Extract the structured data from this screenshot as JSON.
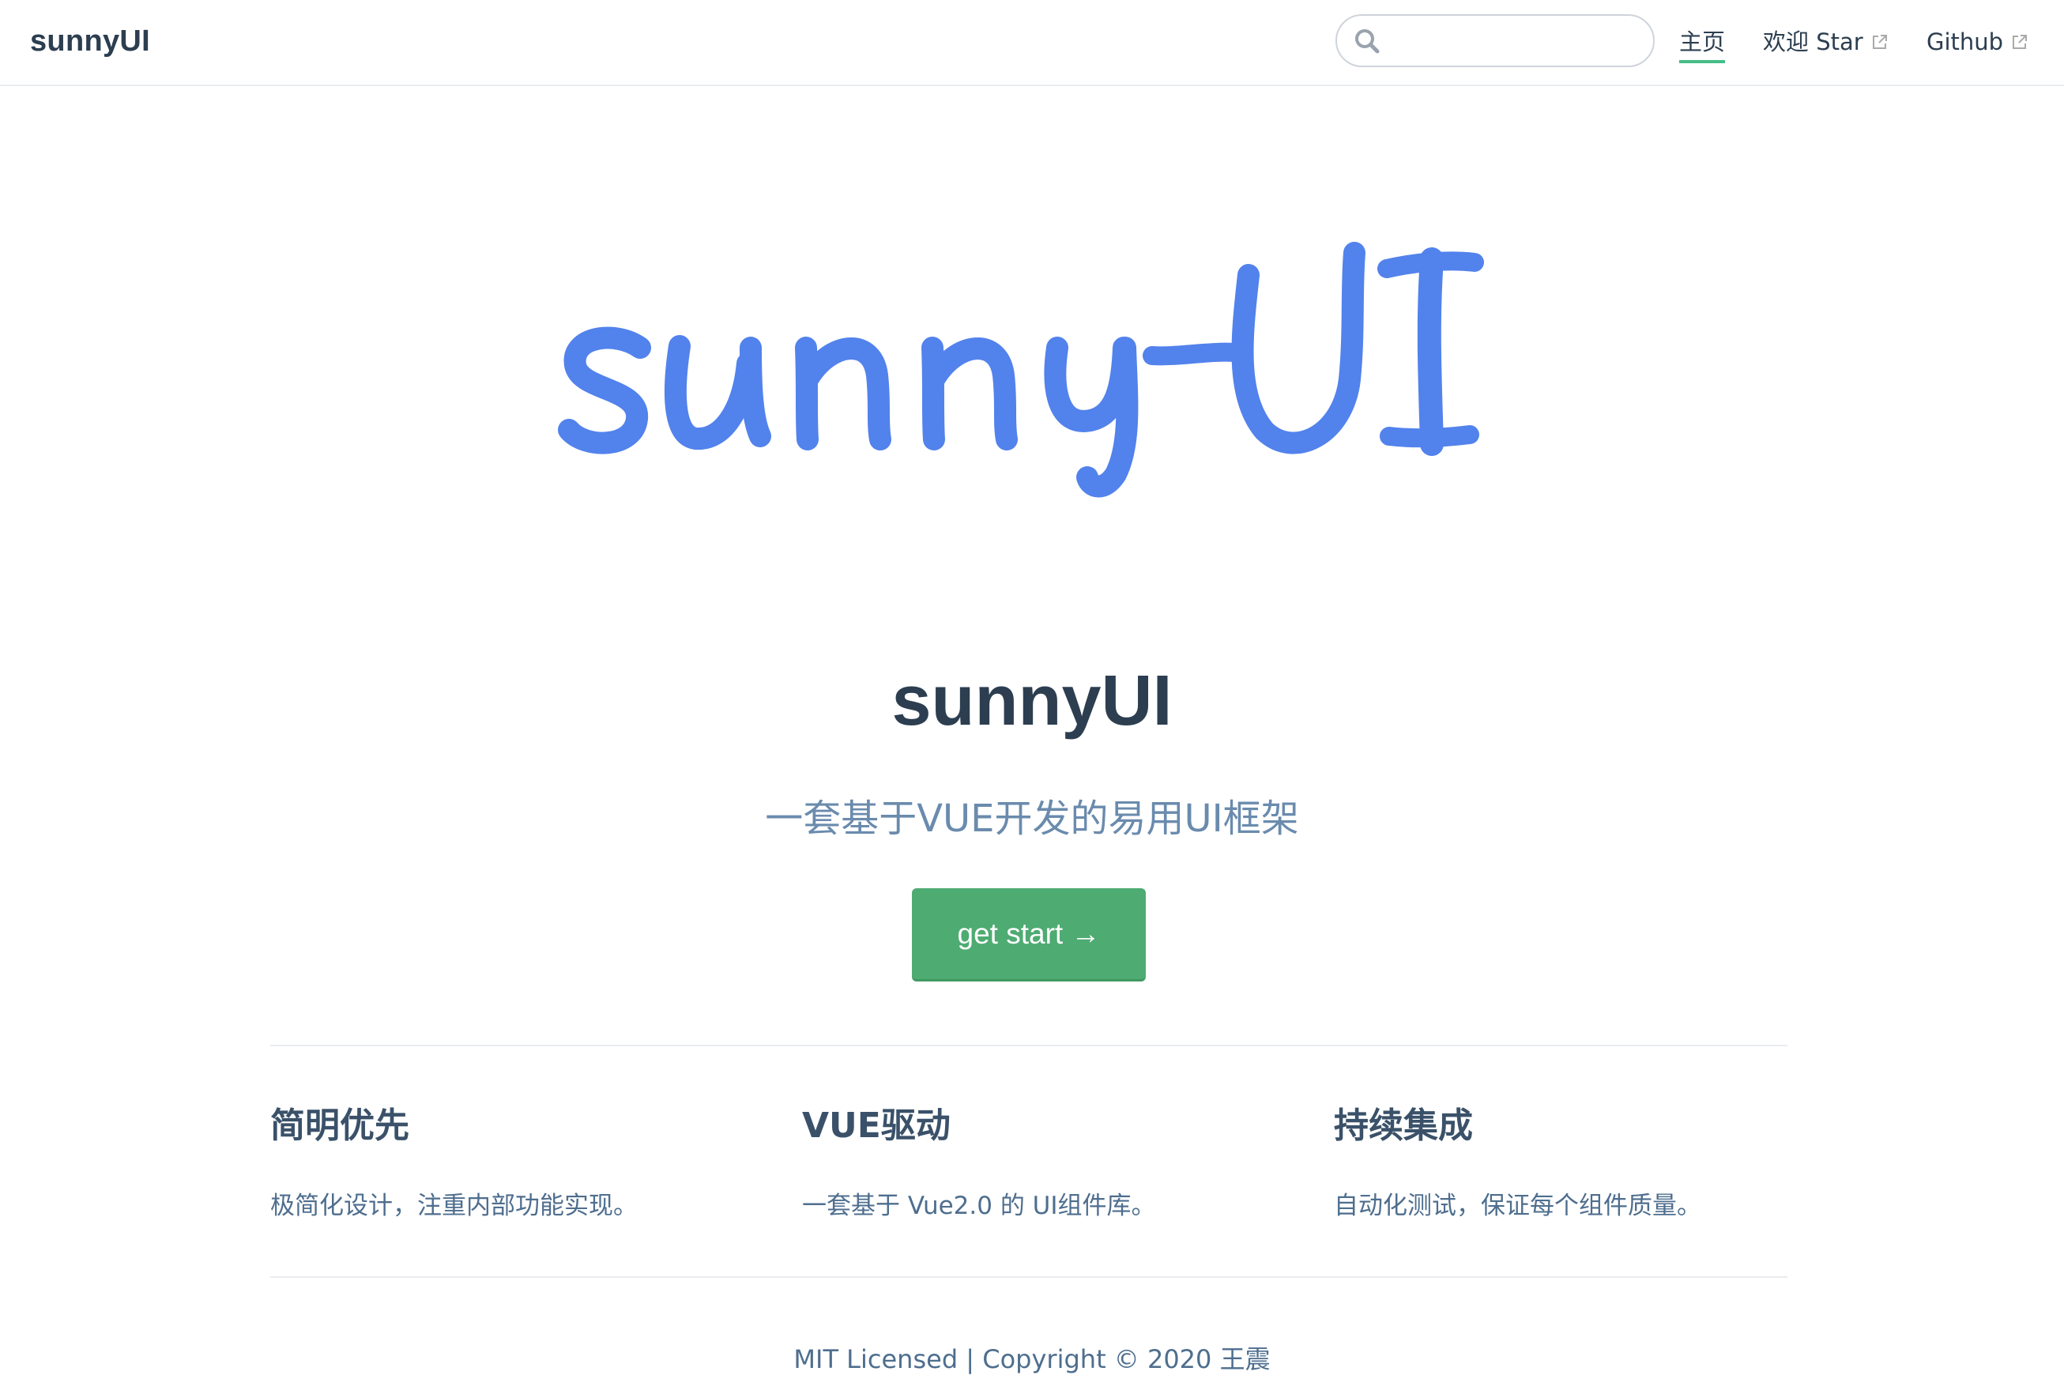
{
  "navbar": {
    "brand": "sunnyUI",
    "search": {
      "value": "",
      "placeholder": ""
    },
    "links": [
      {
        "label": "主页",
        "active": true,
        "external": false
      },
      {
        "label": "欢迎 Star",
        "active": false,
        "external": true
      },
      {
        "label": "Github",
        "active": false,
        "external": true
      }
    ]
  },
  "hero": {
    "logo_text": "sunny-UI",
    "title": "sunnyUI",
    "description": "一套基于VUE开发的易用UI框架",
    "action_label": "get start →"
  },
  "features": [
    {
      "title": "简明优先",
      "description": "极简化设计，注重内部功能实现。"
    },
    {
      "title": "VUE驱动",
      "description": "一套基于 Vue2.0 的 UI组件库。"
    },
    {
      "title": "持续集成",
      "description": "自动化测试，保证每个组件质量。"
    }
  ],
  "footer": {
    "text": "MIT Licensed | Copyright © 2020 王震"
  },
  "colors": {
    "accent": "#4eab72",
    "logo_blue": "#5282ec",
    "text": "#2c3e50",
    "muted": "#6a8bad",
    "active_underline": "#46bd87"
  }
}
